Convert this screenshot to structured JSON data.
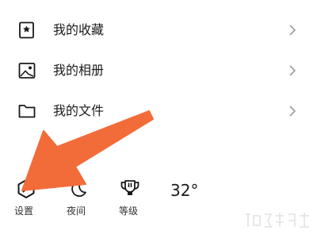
{
  "menu": {
    "items": [
      {
        "label": "我的收藏",
        "icon": "bookmark-star-icon"
      },
      {
        "label": "我的相册",
        "icon": "photo-album-icon"
      },
      {
        "label": "我的文件",
        "icon": "folder-icon"
      }
    ]
  },
  "bottom_bar": {
    "settings": {
      "label": "设置",
      "icon": "hexagon-slash-settings-icon"
    },
    "night": {
      "label": "夜间",
      "icon": "crescent-moon-icon"
    },
    "level": {
      "label": "等级",
      "icon": "trophy-cup-icon"
    },
    "temperature": "32°"
  },
  "annotation": {
    "arrow_color": "#f26c3a",
    "points_to": "settings"
  },
  "colors": {
    "text": "#1a1a1a",
    "chevron": "#9a9a9a",
    "label": "#333333"
  }
}
